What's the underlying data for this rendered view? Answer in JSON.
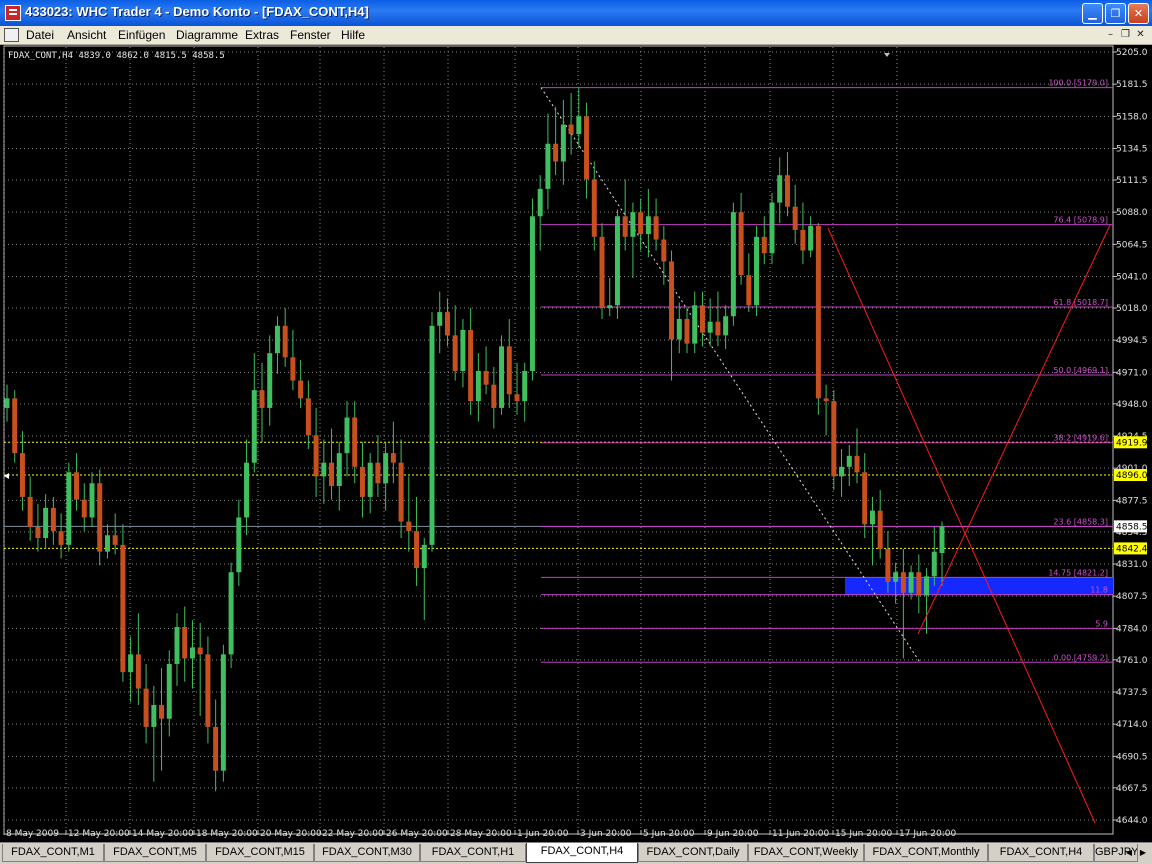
{
  "window": {
    "title": "433023: WHC Trader 4 - Demo Konto - [FDAX_CONT,H4]"
  },
  "menu": [
    "Datei",
    "Ansicht",
    "Einfügen",
    "Diagramme",
    "Extras",
    "Fenster",
    "Hilfe"
  ],
  "chart": {
    "info": "FDAX_CONT,H4  4839.0 4862.0 4815.5 4858.5",
    "badges": [
      "4919.9",
      "4896.0",
      "4858.5",
      "4842.4"
    ]
  },
  "tabs": [
    {
      "label": "FDAX_CONT,M1",
      "active": false
    },
    {
      "label": "FDAX_CONT,M5",
      "active": false
    },
    {
      "label": "FDAX_CONT,M15",
      "active": false
    },
    {
      "label": "FDAX_CONT,M30",
      "active": false
    },
    {
      "label": "FDAX_CONT,H1",
      "active": false
    },
    {
      "label": "FDAX_CONT,H4",
      "active": true
    },
    {
      "label": "FDAX_CONT,Daily",
      "active": false
    },
    {
      "label": "FDAX_CONT,Weekly",
      "active": false
    },
    {
      "label": "FDAX_CONT,Monthly",
      "active": false
    },
    {
      "label": "FDAX_CONT,H4",
      "active": false
    },
    {
      "label": "GBPJPY",
      "active": false
    }
  ],
  "colors": {
    "background": "#000000",
    "bull": "#3fbf5f",
    "bear": "#c8501e",
    "fib": "#c040c0",
    "yellow_level": "#ffff00",
    "trend": "#ff1a1a",
    "zone": "#1428ff",
    "fib_text": "#d050d0"
  },
  "chart_data": {
    "type": "candlestick",
    "symbol": "FDAX_CONT",
    "timeframe": "H4",
    "y_ticks": [
      5205.0,
      5181.5,
      5158.0,
      5134.5,
      5111.5,
      5088.0,
      5064.5,
      5041.0,
      5018.0,
      4994.5,
      4971.0,
      4948.0,
      4924.5,
      4901.0,
      4877.5,
      4854.5,
      4831.0,
      4807.5,
      4784.0,
      4761.0,
      4737.5,
      4714.0,
      4690.5,
      4667.5,
      4644.0
    ],
    "x_ticks": [
      "8 May 2009",
      "12 May 20:00",
      "14 May 20:00",
      "18 May 20:00",
      "20 May 20:00",
      "22 May 20:00",
      "26 May 20:00",
      "28 May 20:00",
      "1 Jun 20:00",
      "3 Jun 20:00",
      "5 Jun 20:00",
      "9 Jun 20:00",
      "11 Jun 20:00",
      "15 Jun 20:00",
      "17 Jun 20:00"
    ],
    "fib_levels": [
      {
        "label": "100.0 [5179.0]",
        "value": 5179.0
      },
      {
        "label": "76.4 [5078.9]",
        "value": 5078.9
      },
      {
        "label": "61.8 [5018.7]",
        "value": 5018.7
      },
      {
        "label": "50.0 [4969.1]",
        "value": 4969.1
      },
      {
        "label": "38.2 [4919.6]",
        "value": 4919.6
      },
      {
        "label": "23.6 [4858.3]",
        "value": 4858.3
      },
      {
        "label": "14.75 [4821.2]",
        "value": 4821.2
      },
      {
        "label": "11.8",
        "value": 4808.6
      },
      {
        "label": "5.9",
        "value": 4784.0
      },
      {
        "label": "0.00 [4759.2]",
        "value": 4759.2
      }
    ],
    "horizontal_levels": [
      4919.9,
      4896.0,
      4858.5,
      4842.4
    ],
    "blue_zone": [
      4808.6,
      4821.2
    ],
    "candles": [
      [
        4945,
        4962,
        4935,
        4952
      ],
      [
        4952,
        4958,
        4905,
        4912
      ],
      [
        4912,
        4928,
        4870,
        4880
      ],
      [
        4880,
        4895,
        4848,
        4858
      ],
      [
        4858,
        4875,
        4840,
        4850
      ],
      [
        4850,
        4882,
        4842,
        4872
      ],
      [
        4872,
        4880,
        4845,
        4855
      ],
      [
        4855,
        4868,
        4835,
        4845
      ],
      [
        4845,
        4905,
        4840,
        4898
      ],
      [
        4898,
        4912,
        4870,
        4878
      ],
      [
        4878,
        4890,
        4855,
        4865
      ],
      [
        4865,
        4898,
        4858,
        4890
      ],
      [
        4890,
        4900,
        4830,
        4840
      ],
      [
        4840,
        4860,
        4835,
        4852
      ],
      [
        4852,
        4868,
        4838,
        4845
      ],
      [
        4845,
        4860,
        4745,
        4752
      ],
      [
        4752,
        4778,
        4730,
        4765
      ],
      [
        4765,
        4795,
        4728,
        4740
      ],
      [
        4740,
        4758,
        4700,
        4712
      ],
      [
        4712,
        4742,
        4672,
        4728
      ],
      [
        4728,
        4755,
        4680,
        4718
      ],
      [
        4718,
        4768,
        4705,
        4758
      ],
      [
        4758,
        4795,
        4742,
        4785
      ],
      [
        4785,
        4800,
        4745,
        4762
      ],
      [
        4762,
        4790,
        4740,
        4770
      ],
      [
        4770,
        4788,
        4720,
        4765
      ],
      [
        4765,
        4778,
        4700,
        4712
      ],
      [
        4712,
        4732,
        4665,
        4680
      ],
      [
        4680,
        4772,
        4672,
        4765
      ],
      [
        4765,
        4832,
        4755,
        4825
      ],
      [
        4825,
        4878,
        4815,
        4865
      ],
      [
        4865,
        4922,
        4852,
        4905
      ],
      [
        4905,
        4985,
        4898,
        4958
      ],
      [
        4958,
        4978,
        4920,
        4945
      ],
      [
        4945,
        4998,
        4932,
        4985
      ],
      [
        4985,
        5012,
        4970,
        5005
      ],
      [
        5005,
        5018,
        4975,
        4982
      ],
      [
        4982,
        5002,
        4958,
        4965
      ],
      [
        4965,
        4980,
        4945,
        4952
      ],
      [
        4952,
        4965,
        4915,
        4925
      ],
      [
        4925,
        4945,
        4880,
        4895
      ],
      [
        4895,
        4922,
        4875,
        4905
      ],
      [
        4905,
        4930,
        4878,
        4888
      ],
      [
        4888,
        4920,
        4870,
        4912
      ],
      [
        4912,
        4950,
        4895,
        4938
      ],
      [
        4938,
        4950,
        4890,
        4902
      ],
      [
        4902,
        4920,
        4865,
        4880
      ],
      [
        4880,
        4912,
        4868,
        4905
      ],
      [
        4905,
        4925,
        4880,
        4890
      ],
      [
        4890,
        4920,
        4870,
        4912
      ],
      [
        4912,
        4935,
        4890,
        4905
      ],
      [
        4905,
        4922,
        4850,
        4862
      ],
      [
        4862,
        4895,
        4840,
        4855
      ],
      [
        4855,
        4880,
        4815,
        4828
      ],
      [
        4828,
        4850,
        4790,
        4845
      ],
      [
        4845,
        5015,
        4840,
        5005
      ],
      [
        5005,
        5030,
        4985,
        5015
      ],
      [
        5015,
        5025,
        4990,
        4998
      ],
      [
        4998,
        5020,
        4965,
        4972
      ],
      [
        4972,
        5010,
        4960,
        5002
      ],
      [
        5002,
        5018,
        4940,
        4950
      ],
      [
        4950,
        4985,
        4935,
        4972
      ],
      [
        4972,
        4990,
        4955,
        4962
      ],
      [
        4962,
        4975,
        4930,
        4945
      ],
      [
        4945,
        4998,
        4940,
        4990
      ],
      [
        4990,
        5010,
        4945,
        4955
      ],
      [
        4955,
        4978,
        4940,
        4950
      ],
      [
        4950,
        4978,
        4935,
        4972
      ],
      [
        4972,
        5098,
        4965,
        5085
      ],
      [
        5085,
        5115,
        5060,
        5105
      ],
      [
        5105,
        5160,
        5090,
        5138
      ],
      [
        5138,
        5165,
        5115,
        5125
      ],
      [
        5125,
        5170,
        5108,
        5152
      ],
      [
        5152,
        5175,
        5130,
        5145
      ],
      [
        5145,
        5179,
        5135,
        5158
      ],
      [
        5158,
        5168,
        5098,
        5112
      ],
      [
        5112,
        5125,
        5060,
        5070
      ],
      [
        5070,
        5080,
        5010,
        5018
      ],
      [
        5018,
        5040,
        5012,
        5020
      ],
      [
        5020,
        5090,
        5010,
        5085
      ],
      [
        5085,
        5112,
        5060,
        5070
      ],
      [
        5070,
        5095,
        5040,
        5088
      ],
      [
        5088,
        5098,
        5060,
        5072
      ],
      [
        5072,
        5105,
        5055,
        5085
      ],
      [
        5085,
        5098,
        5060,
        5068
      ],
      [
        5068,
        5078,
        5035,
        5052
      ],
      [
        5052,
        5060,
        4965,
        4995
      ],
      [
        4995,
        5022,
        4985,
        5010
      ],
      [
        5010,
        5018,
        4985,
        4992
      ],
      [
        4992,
        5030,
        4985,
        5020
      ],
      [
        5020,
        5030,
        4990,
        5000
      ],
      [
        5000,
        5025,
        4990,
        5008
      ],
      [
        5008,
        5030,
        4990,
        4998
      ],
      [
        4998,
        5020,
        4988,
        5012
      ],
      [
        5012,
        5095,
        5005,
        5088
      ],
      [
        5088,
        5102,
        5035,
        5042
      ],
      [
        5042,
        5058,
        5015,
        5020
      ],
      [
        5020,
        5078,
        5012,
        5070
      ],
      [
        5070,
        5085,
        5050,
        5058
      ],
      [
        5058,
        5102,
        5050,
        5095
      ],
      [
        5095,
        5128,
        5080,
        5115
      ],
      [
        5115,
        5132,
        5085,
        5092
      ],
      [
        5092,
        5108,
        5065,
        5075
      ],
      [
        5075,
        5095,
        5050,
        5060
      ],
      [
        5060,
        5085,
        5055,
        5078
      ],
      [
        5078,
        5080,
        4940,
        4952
      ],
      [
        4952,
        4962,
        4925,
        4950
      ],
      [
        4950,
        4958,
        4885,
        4895
      ],
      [
        4895,
        4915,
        4880,
        4902
      ],
      [
        4902,
        4918,
        4888,
        4910
      ],
      [
        4910,
        4930,
        4890,
        4898
      ],
      [
        4898,
        4912,
        4850,
        4860
      ],
      [
        4860,
        4880,
        4830,
        4870
      ],
      [
        4870,
        4885,
        4835,
        4842
      ],
      [
        4842,
        4855,
        4810,
        4818
      ],
      [
        4818,
        4832,
        4802,
        4825
      ],
      [
        4825,
        4842,
        4762,
        4810
      ],
      [
        4810,
        4830,
        4805,
        4825
      ],
      [
        4825,
        4838,
        4795,
        4808
      ],
      [
        4808,
        4828,
        4780,
        4822
      ],
      [
        4822,
        4858,
        4815,
        4840
      ],
      [
        4839,
        4862,
        4815,
        4858.5
      ]
    ]
  }
}
